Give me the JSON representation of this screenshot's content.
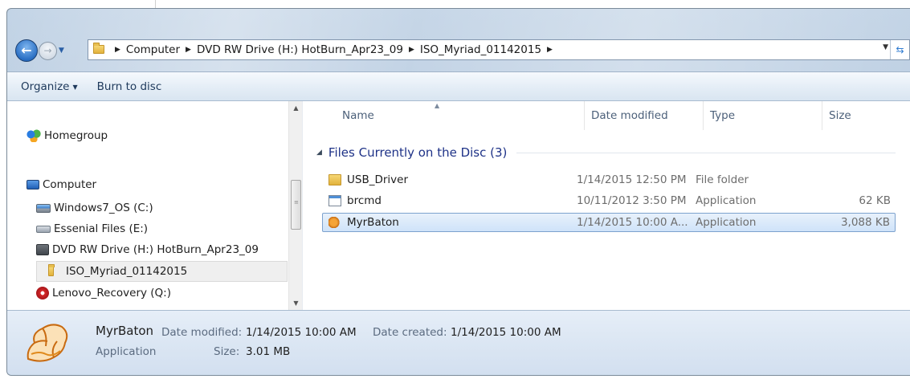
{
  "window": {
    "breadcrumbs": [
      "Computer",
      "DVD RW Drive (H:) HotBurn_Apr23_09",
      "ISO_Myriad_01142015"
    ]
  },
  "toolbar": {
    "organize_label": "Organize",
    "burn_label": "Burn to disc"
  },
  "nav": {
    "items": [
      {
        "label": "Homegroup",
        "icon": "homegroup-icon"
      },
      {
        "label": "Computer",
        "icon": "computer-icon"
      },
      {
        "label": "Windows7_OS (C:)",
        "icon": "drive-icon"
      },
      {
        "label": "Essenial Files (E:)",
        "icon": "drive-icon"
      },
      {
        "label": "DVD RW Drive (H:) HotBurn_Apr23_09",
        "icon": "dvd-drive-icon"
      },
      {
        "label": "ISO_Myriad_01142015",
        "icon": "folder-icon"
      },
      {
        "label": "Lenovo_Recovery (Q:)",
        "icon": "recovery-drive-icon"
      }
    ]
  },
  "columns": {
    "name": "Name",
    "date": "Date modified",
    "type": "Type",
    "size": "Size"
  },
  "group": {
    "label": "Files Currently on the Disc (3)"
  },
  "files": [
    {
      "name": "USB_Driver",
      "date": "1/14/2015 12:50 PM",
      "type": "File folder",
      "size": "",
      "icon": "folder-icon"
    },
    {
      "name": "brcmd",
      "date": "10/11/2012 3:50 PM",
      "type": "Application",
      "size": "62 KB",
      "icon": "application-icon"
    },
    {
      "name": "MyrBaton",
      "date": "1/14/2015 10:00 A...",
      "type": "Application",
      "size": "3,088 KB",
      "icon": "baton-app-icon",
      "selected": true
    }
  ],
  "details": {
    "name": "MyrBaton",
    "type": "Application",
    "date_modified_label": "Date modified:",
    "date_modified": "1/14/2015 10:00 AM",
    "date_created_label": "Date created:",
    "date_created": "1/14/2015 10:00 AM",
    "size_label": "Size:",
    "size": "3.01 MB"
  }
}
